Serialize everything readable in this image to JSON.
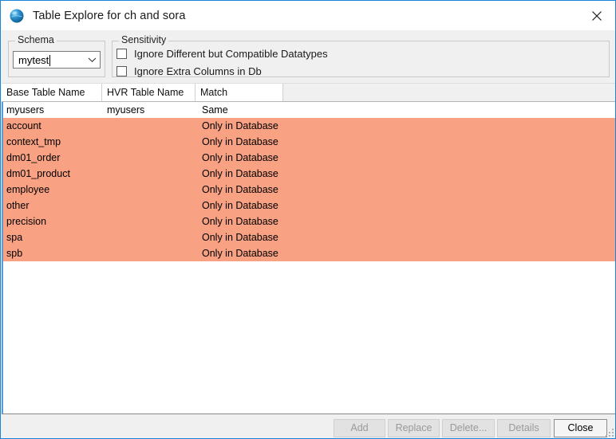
{
  "window": {
    "title": "Table Explore for ch and sora",
    "icon": "sphere-icon",
    "close_icon": "close-icon",
    "accent_color": "#1883d7"
  },
  "schema_group": {
    "legend": "Schema",
    "combo": {
      "value": "mytest",
      "arrow_icon": "chevron-down-icon"
    }
  },
  "sensitivity_group": {
    "legend": "Sensitivity",
    "checkboxes": [
      {
        "label": "Ignore Different but Compatible Datatypes",
        "checked": false
      },
      {
        "label": "Ignore Extra Columns in Db",
        "checked": false
      }
    ]
  },
  "table": {
    "columns": [
      "Base Table Name",
      "HVR Table Name",
      "Match"
    ],
    "highlight_color": "#f8a183",
    "rows": [
      {
        "base": "myusers",
        "hvr": "myusers",
        "match": "Same",
        "state": "normal"
      },
      {
        "base": "account",
        "hvr": "",
        "match": "Only in Database",
        "state": "only-db"
      },
      {
        "base": "context_tmp",
        "hvr": "",
        "match": "Only in Database",
        "state": "only-db"
      },
      {
        "base": "dm01_order",
        "hvr": "",
        "match": "Only in Database",
        "state": "only-db"
      },
      {
        "base": "dm01_product",
        "hvr": "",
        "match": "Only in Database",
        "state": "only-db"
      },
      {
        "base": "employee",
        "hvr": "",
        "match": "Only in Database",
        "state": "only-db"
      },
      {
        "base": "other",
        "hvr": "",
        "match": "Only in Database",
        "state": "only-db"
      },
      {
        "base": "precision",
        "hvr": "",
        "match": "Only in Database",
        "state": "only-db"
      },
      {
        "base": "spa",
        "hvr": "",
        "match": "Only in Database",
        "state": "only-db"
      },
      {
        "base": "spb",
        "hvr": "",
        "match": "Only in Database",
        "state": "only-db"
      }
    ]
  },
  "buttons": {
    "add": {
      "label": "Add",
      "enabled": false
    },
    "replace": {
      "label": "Replace",
      "enabled": false
    },
    "delete": {
      "label": "Delete...",
      "enabled": false
    },
    "details": {
      "label": "Details",
      "enabled": false
    },
    "close": {
      "label": "Close",
      "enabled": true
    }
  }
}
